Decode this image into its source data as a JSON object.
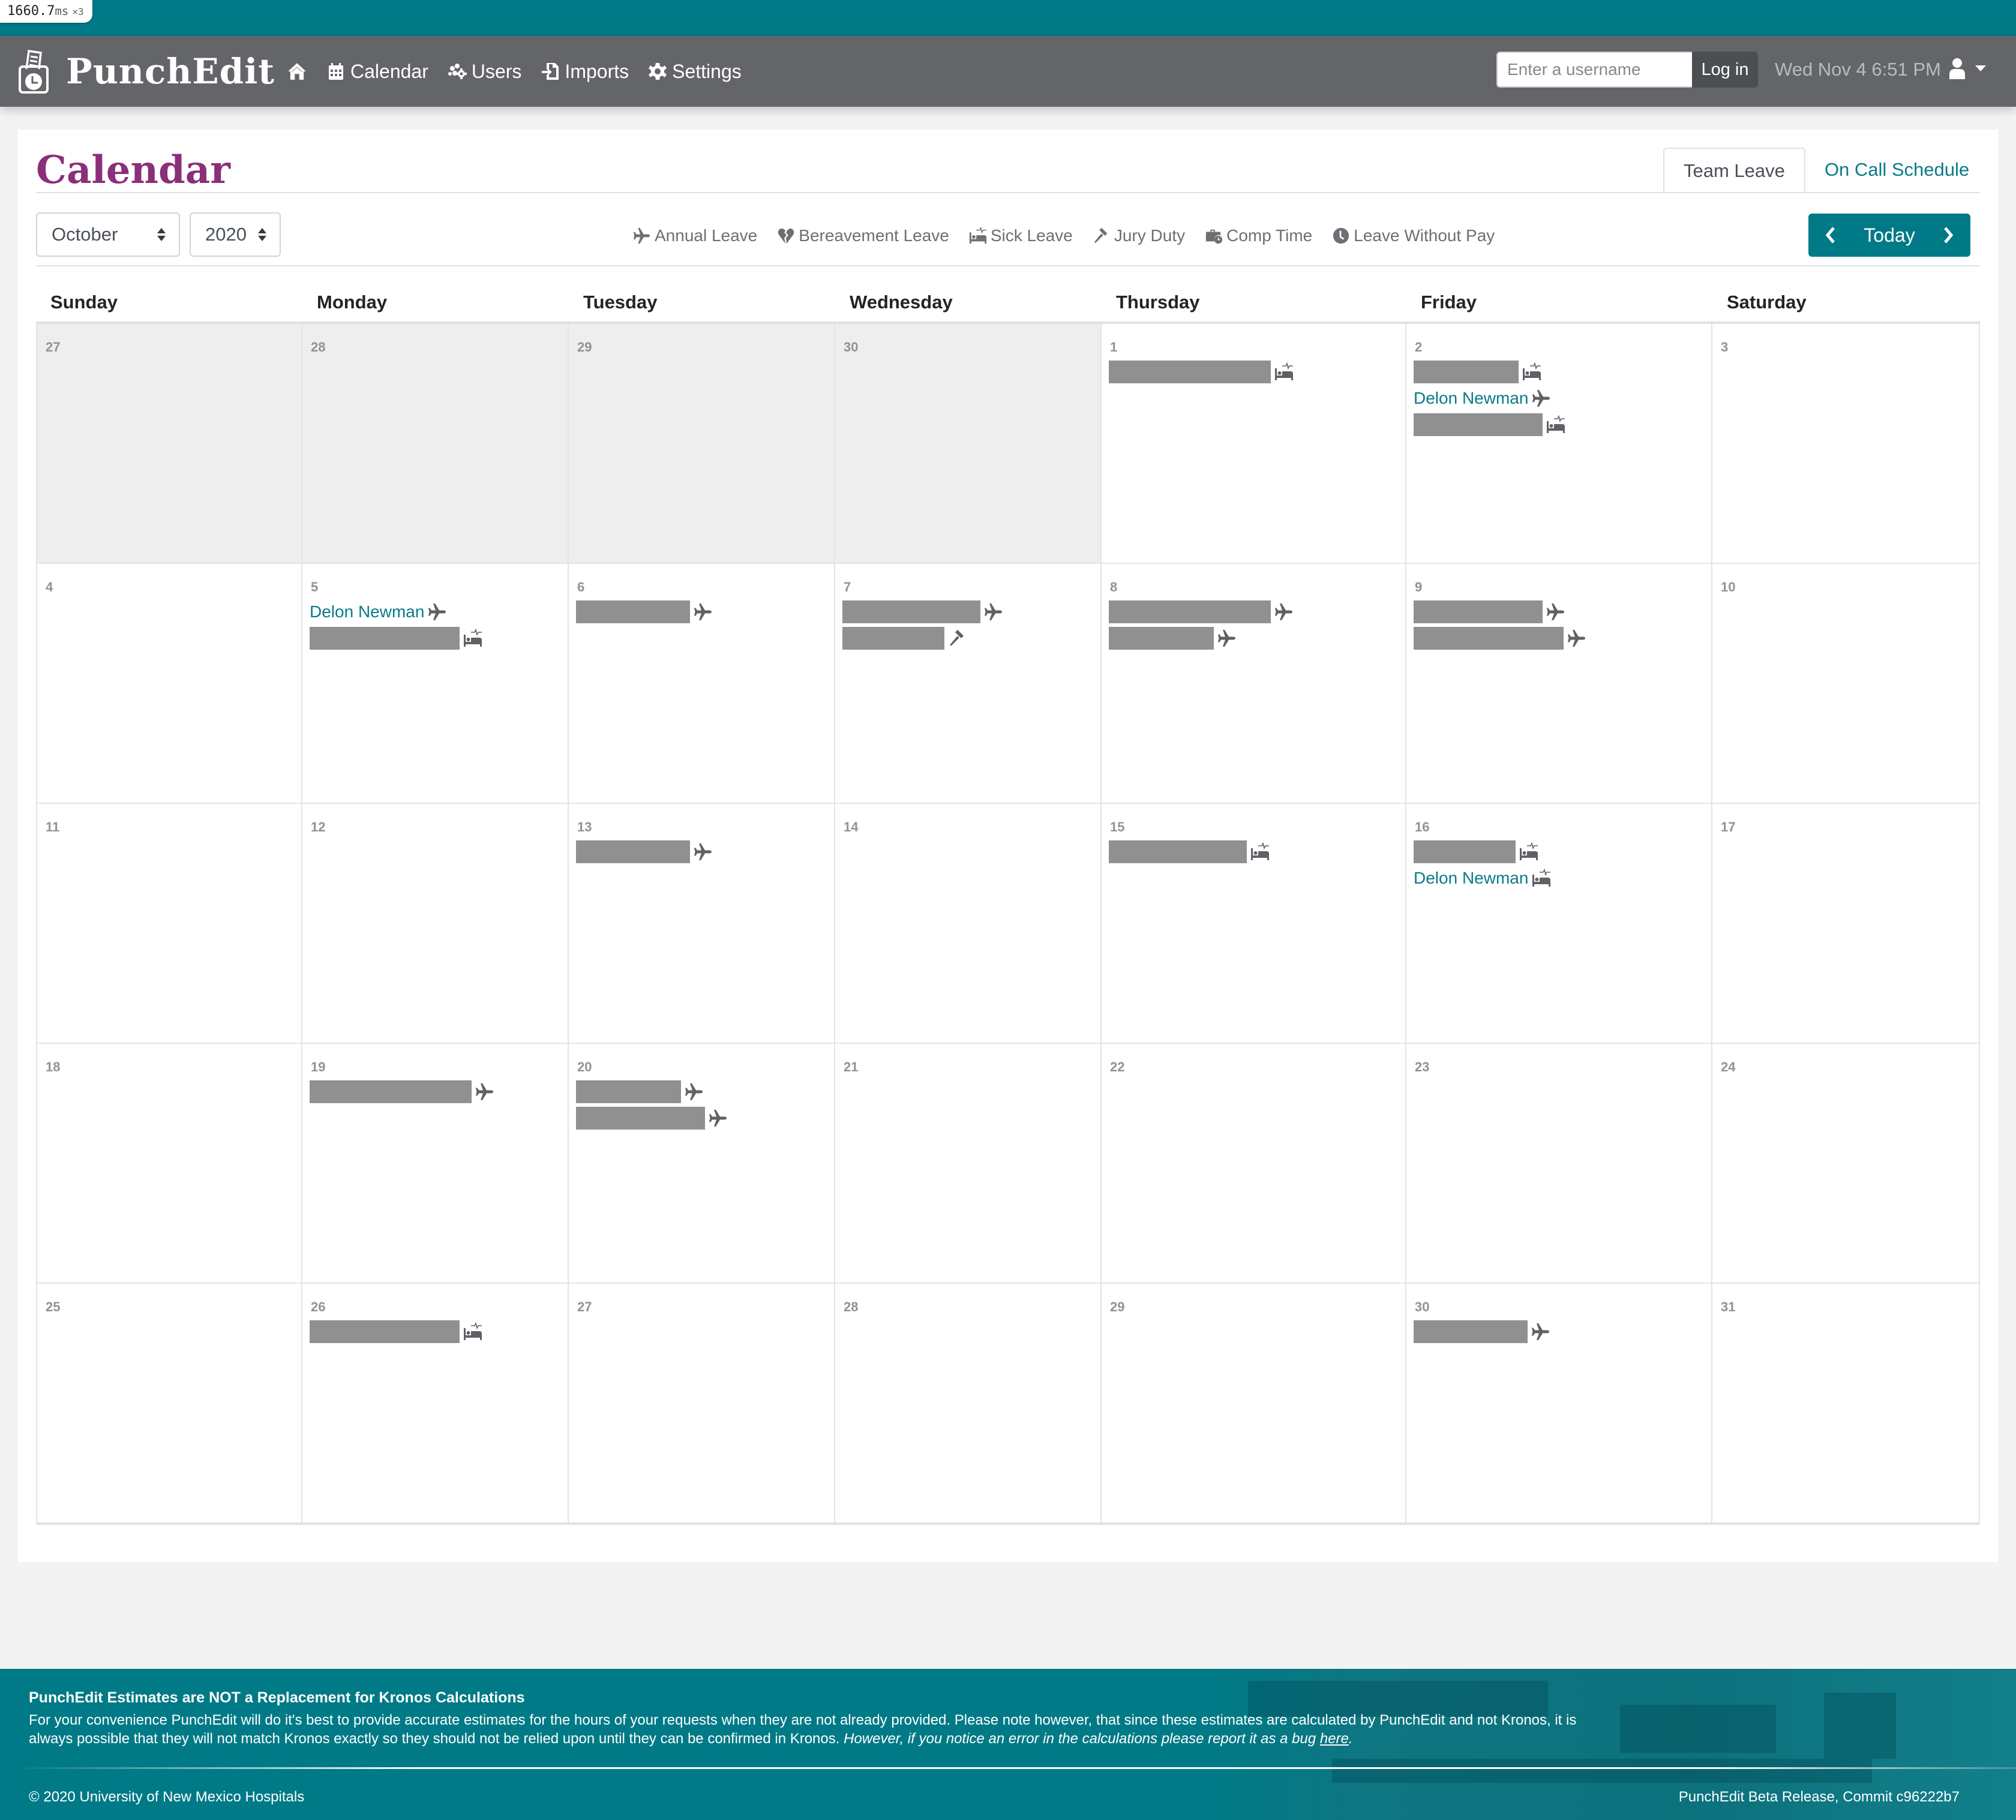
{
  "perf_badge": {
    "value": "1660.7",
    "unit": "ms",
    "multiplier": "×3"
  },
  "navbar": {
    "brand": "PunchEdit",
    "items": [
      {
        "label": "",
        "icon": "home-icon"
      },
      {
        "label": "Calendar",
        "icon": "calendar-icon"
      },
      {
        "label": "Users",
        "icon": "users-icon"
      },
      {
        "label": "Imports",
        "icon": "import-icon"
      },
      {
        "label": "Settings",
        "icon": "gear-icon"
      }
    ],
    "login": {
      "placeholder": "Enter a username",
      "value": "",
      "button": "Log in"
    },
    "clock": "Wed Nov 4 6:51 PM"
  },
  "page": {
    "title": "Calendar",
    "tabs": [
      {
        "label": "Team Leave",
        "active": true
      },
      {
        "label": "On Call Schedule",
        "active": false
      }
    ],
    "month_select": "October",
    "year_select": "2020",
    "legend": [
      {
        "label": "Annual Leave",
        "icon": "plane-icon"
      },
      {
        "label": "Bereavement Leave",
        "icon": "broken-heart-icon"
      },
      {
        "label": "Sick Leave",
        "icon": "procedures-bed-icon"
      },
      {
        "label": "Jury Duty",
        "icon": "gavel-icon"
      },
      {
        "label": "Comp Time",
        "icon": "briefcase-clock-icon"
      },
      {
        "label": "Leave Without Pay",
        "icon": "clock-icon"
      }
    ],
    "today_button": "Today"
  },
  "calendar": {
    "weekdays": [
      "Sunday",
      "Monday",
      "Tuesday",
      "Wednesday",
      "Thursday",
      "Friday",
      "Saturday"
    ],
    "weeks": [
      [
        {
          "day": "27",
          "other_month": true,
          "entries": []
        },
        {
          "day": "28",
          "other_month": true,
          "entries": []
        },
        {
          "day": "29",
          "other_month": true,
          "entries": []
        },
        {
          "day": "30",
          "other_month": true,
          "entries": []
        },
        {
          "day": "1",
          "entries": [
            {
              "name": "[redacted]",
              "redacted": true,
              "type": "sick"
            }
          ]
        },
        {
          "day": "2",
          "entries": [
            {
              "name": "[redacted]",
              "redacted": true,
              "type": "sick"
            },
            {
              "name": "Delon Newman",
              "type": "annual"
            },
            {
              "name": "[redacted]",
              "redacted": true,
              "type": "sick"
            }
          ]
        },
        {
          "day": "3",
          "entries": []
        }
      ],
      [
        {
          "day": "4",
          "entries": []
        },
        {
          "day": "5",
          "entries": [
            {
              "name": "Delon Newman",
              "type": "annual"
            },
            {
              "name": "[redacted]",
              "redacted": true,
              "type": "sick"
            }
          ]
        },
        {
          "day": "6",
          "entries": [
            {
              "name": "[redacted]",
              "redacted": true,
              "type": "annual"
            }
          ]
        },
        {
          "day": "7",
          "entries": [
            {
              "name": "[redacted]",
              "redacted": true,
              "type": "annual"
            },
            {
              "name": "[redacted]",
              "redacted": true,
              "type": "jury"
            }
          ]
        },
        {
          "day": "8",
          "entries": [
            {
              "name": "[redacted]",
              "redacted": true,
              "type": "annual"
            },
            {
              "name": "[redacted]",
              "redacted": true,
              "type": "annual"
            }
          ]
        },
        {
          "day": "9",
          "entries": [
            {
              "name": "[redacted]",
              "redacted": true,
              "type": "annual"
            },
            {
              "name": "[redacted]",
              "redacted": true,
              "type": "annual"
            }
          ]
        },
        {
          "day": "10",
          "entries": []
        }
      ],
      [
        {
          "day": "11",
          "entries": []
        },
        {
          "day": "12",
          "entries": []
        },
        {
          "day": "13",
          "entries": [
            {
              "name": "[redacted]",
              "redacted": true,
              "type": "annual"
            }
          ]
        },
        {
          "day": "14",
          "entries": []
        },
        {
          "day": "15",
          "entries": [
            {
              "name": "[redacted]",
              "redacted": true,
              "type": "sick"
            }
          ]
        },
        {
          "day": "16",
          "entries": [
            {
              "name": "[redacted]",
              "redacted": true,
              "type": "sick"
            },
            {
              "name": "Delon Newman",
              "type": "sick"
            }
          ]
        },
        {
          "day": "17",
          "entries": []
        }
      ],
      [
        {
          "day": "18",
          "entries": []
        },
        {
          "day": "19",
          "entries": [
            {
              "name": "[redacted]",
              "redacted": true,
              "type": "annual"
            }
          ]
        },
        {
          "day": "20",
          "entries": [
            {
              "name": "[redacted]",
              "redacted": true,
              "type": "annual"
            },
            {
              "name": "[redacted]",
              "redacted": true,
              "type": "annual"
            }
          ]
        },
        {
          "day": "21",
          "entries": []
        },
        {
          "day": "22",
          "entries": []
        },
        {
          "day": "23",
          "entries": []
        },
        {
          "day": "24",
          "entries": []
        }
      ],
      [
        {
          "day": "25",
          "entries": []
        },
        {
          "day": "26",
          "entries": [
            {
              "name": "[redacted]",
              "redacted": true,
              "type": "sick"
            }
          ]
        },
        {
          "day": "27",
          "entries": []
        },
        {
          "day": "28",
          "entries": []
        },
        {
          "day": "29",
          "entries": []
        },
        {
          "day": "30",
          "entries": [
            {
              "name": "[redacted]",
              "redacted": true,
              "type": "annual"
            }
          ]
        },
        {
          "day": "31",
          "entries": []
        }
      ]
    ]
  },
  "footer": {
    "heading": "PunchEdit Estimates are NOT a Replacement for Kronos Calculations",
    "notice": "For your convenience PunchEdit will do it's best to provide accurate estimates for the hours of your requests when they are not already provided. Please note however, that since these estimates are calculated by PunchEdit and not Kronos, it is always possible that they will not match Kronos exactly so they should not be relied upon until they can be confirmed in Kronos. ",
    "notice_italic": "However, if you notice an error in the calculations please report it as a bug ",
    "notice_link": "here",
    "copyright": "© 2020 University of New Mexico Hospitals",
    "commit": "PunchEdit Beta Release, Commit c96222b7"
  },
  "colors": {
    "teal": "#007a86",
    "navbar": "#636569",
    "title": "#8a2f7a",
    "link": "#0a7b86"
  }
}
